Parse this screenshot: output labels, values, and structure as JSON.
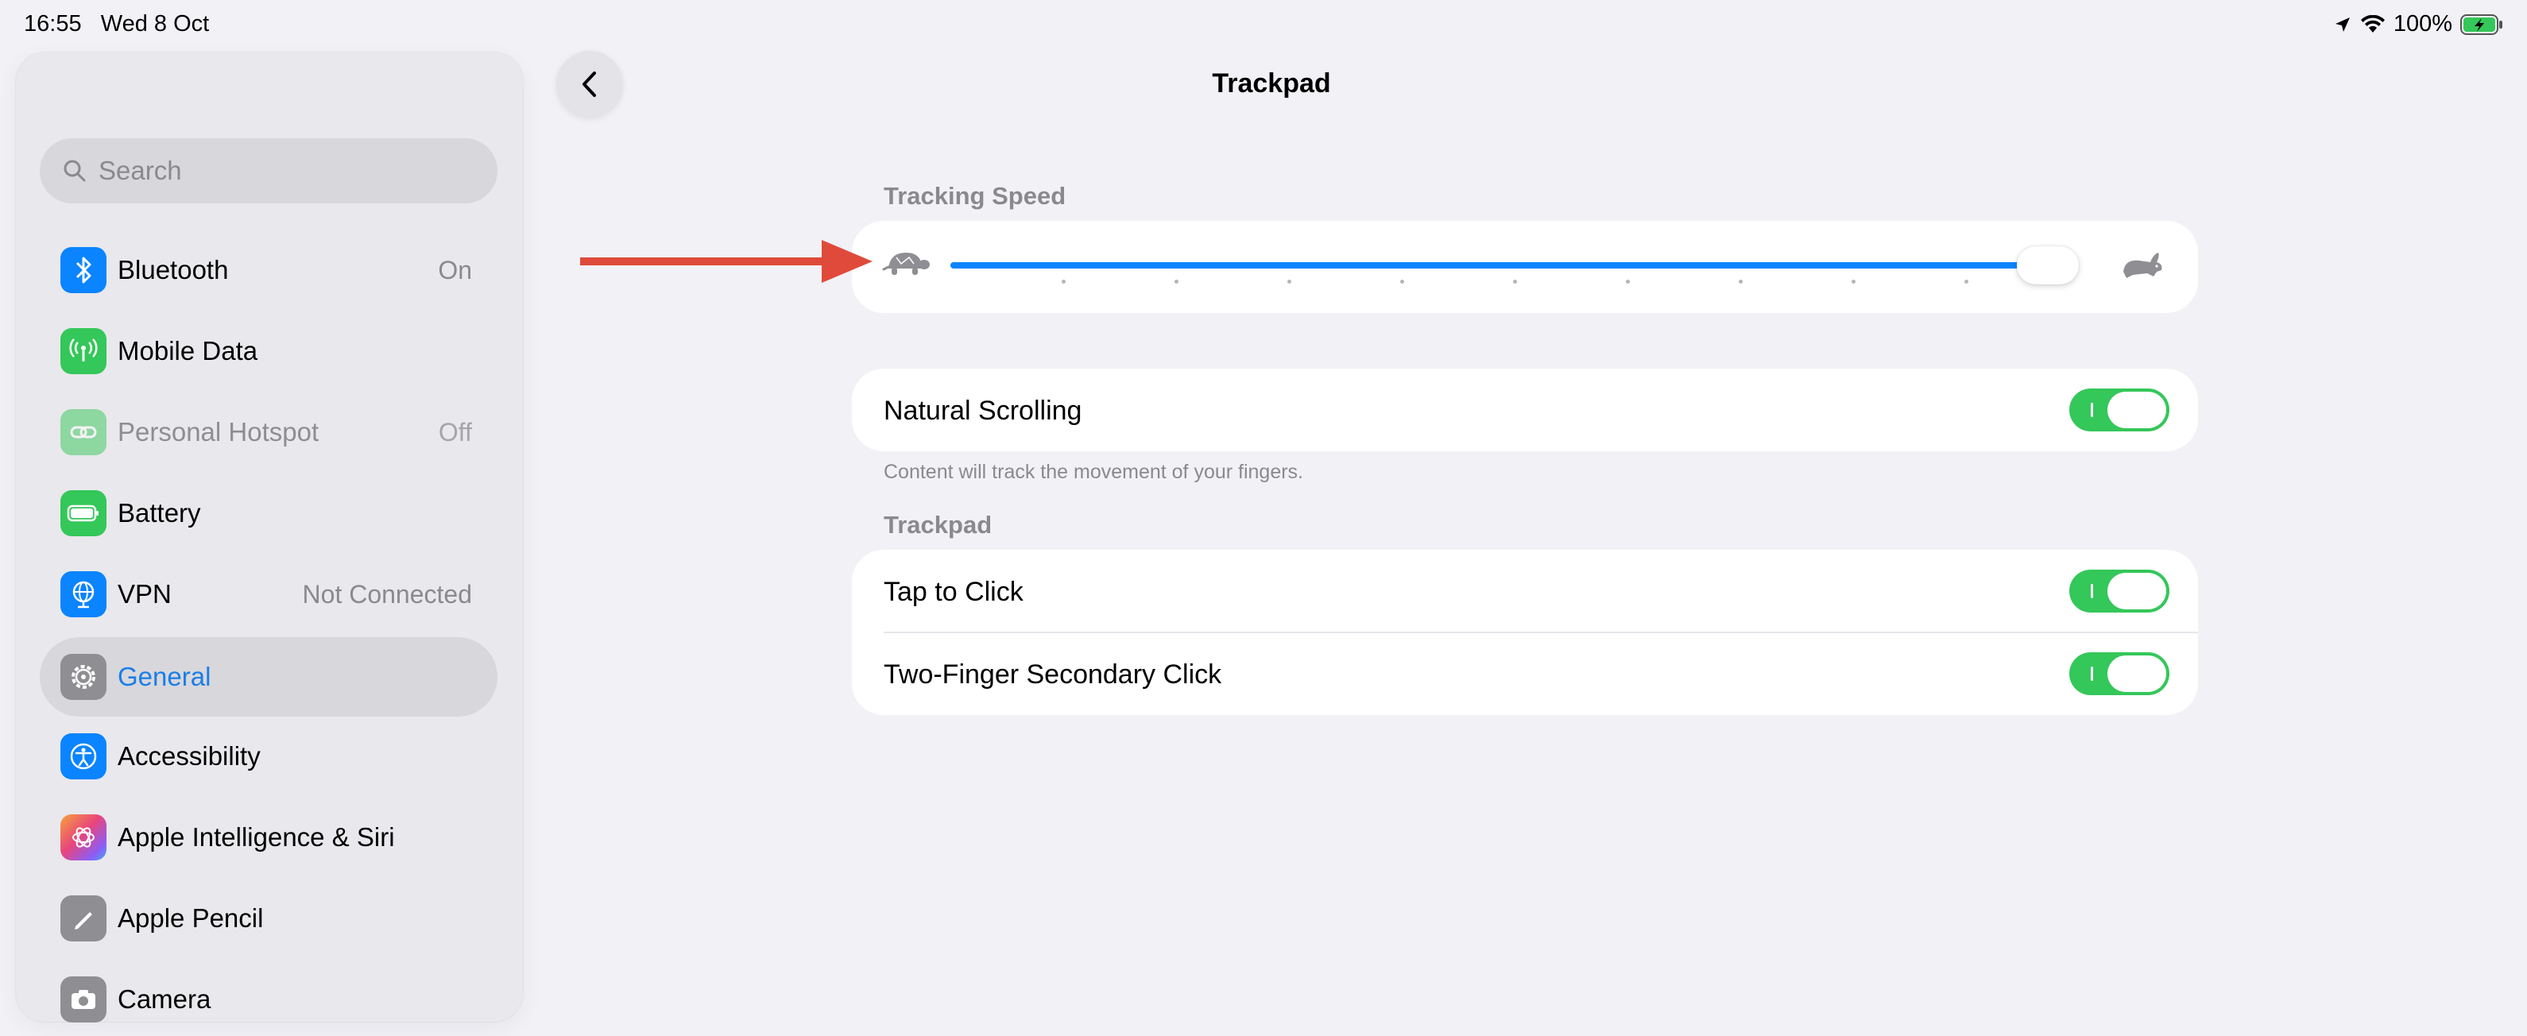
{
  "status_bar": {
    "time": "16:55",
    "date": "Wed 8 Oct",
    "battery": "100%"
  },
  "sidebar": {
    "search_placeholder": "Search",
    "items": [
      {
        "label": "Bluetooth",
        "value": "On",
        "icon": "bluetooth-icon",
        "color": "#0a84ff"
      },
      {
        "label": "Mobile Data",
        "value": "",
        "icon": "antenna-icon",
        "color": "#34c759"
      },
      {
        "label": "Personal Hotspot",
        "value": "Off",
        "icon": "link-icon",
        "color": "#34c759"
      },
      {
        "label": "Battery",
        "value": "",
        "icon": "battery-icon",
        "color": "#34c759"
      },
      {
        "label": "VPN",
        "value": "Not Connected",
        "icon": "globe-icon",
        "color": "#0a84ff"
      },
      {
        "label": "General",
        "value": "",
        "icon": "gear-icon",
        "color": "#8e8e93"
      },
      {
        "label": "Accessibility",
        "value": "",
        "icon": "accessibility-icon",
        "color": "#0a84ff"
      },
      {
        "label": "Apple Intelligence & Siri",
        "value": "",
        "icon": "siri-icon",
        "color": "#d65ac8"
      },
      {
        "label": "Apple Pencil",
        "value": "",
        "icon": "pencil-icon",
        "color": "#8e8e93"
      },
      {
        "label": "Camera",
        "value": "",
        "icon": "camera-icon",
        "color": "#8e8e93"
      }
    ]
  },
  "header": {
    "title": "Trackpad"
  },
  "tracking_speed": {
    "header": "Tracking Speed",
    "value": 0.98,
    "tick_count": 9,
    "accent": "#0a84ff"
  },
  "natural_scrolling": {
    "label": "Natural Scrolling",
    "enabled": true,
    "footnote": "Content will track the movement of your fingers."
  },
  "trackpad_section": {
    "header": "Trackpad",
    "rows": [
      {
        "label": "Tap to Click",
        "enabled": true
      },
      {
        "label": "Two-Finger Secondary Click",
        "enabled": true
      }
    ]
  },
  "colors": {
    "toggle_on": "#34c759",
    "selected_text": "#1a7ee6",
    "annotation_arrow": "#e04a3a"
  }
}
